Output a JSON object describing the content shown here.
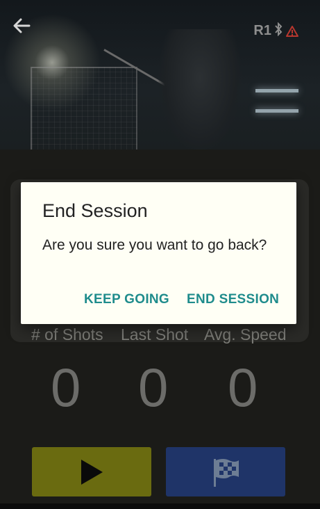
{
  "header": {
    "device_label": "R1",
    "icons": [
      "back-arrow-icon",
      "bluetooth-icon",
      "warning-icon"
    ]
  },
  "stats": {
    "shots_label": "# of Shots",
    "last_shot_label": "Last Shot",
    "avg_speed_label": "Avg. Speed",
    "shots_value": "0",
    "last_shot_value": "0",
    "avg_speed_value": "0"
  },
  "dialog": {
    "title": "End Session",
    "message": "Are you sure you want to go back?",
    "keep_going_label": "KEEP GOING",
    "end_session_label": "END SESSION"
  },
  "buttons": {
    "play_icon": "play-icon",
    "finish_icon": "checkered-flag-icon"
  },
  "colors": {
    "accent": "#1f8c8c",
    "play_button": "#6a6b10",
    "finish_button": "#1f3468",
    "warning": "#c0392b"
  }
}
